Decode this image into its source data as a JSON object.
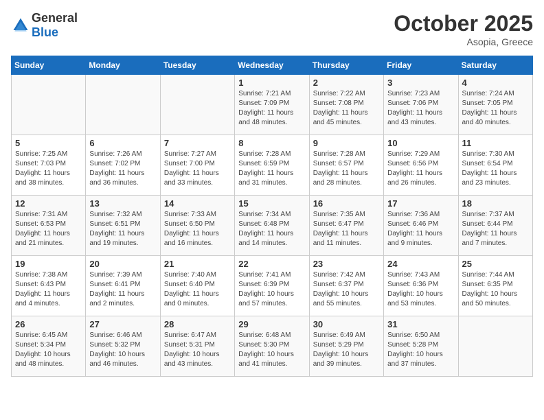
{
  "logo": {
    "general": "General",
    "blue": "Blue"
  },
  "title": "October 2025",
  "location": "Asopia, Greece",
  "weekdays": [
    "Sunday",
    "Monday",
    "Tuesday",
    "Wednesday",
    "Thursday",
    "Friday",
    "Saturday"
  ],
  "weeks": [
    [
      {
        "day": "",
        "info": ""
      },
      {
        "day": "",
        "info": ""
      },
      {
        "day": "",
        "info": ""
      },
      {
        "day": "1",
        "info": "Sunrise: 7:21 AM\nSunset: 7:09 PM\nDaylight: 11 hours\nand 48 minutes."
      },
      {
        "day": "2",
        "info": "Sunrise: 7:22 AM\nSunset: 7:08 PM\nDaylight: 11 hours\nand 45 minutes."
      },
      {
        "day": "3",
        "info": "Sunrise: 7:23 AM\nSunset: 7:06 PM\nDaylight: 11 hours\nand 43 minutes."
      },
      {
        "day": "4",
        "info": "Sunrise: 7:24 AM\nSunset: 7:05 PM\nDaylight: 11 hours\nand 40 minutes."
      }
    ],
    [
      {
        "day": "5",
        "info": "Sunrise: 7:25 AM\nSunset: 7:03 PM\nDaylight: 11 hours\nand 38 minutes."
      },
      {
        "day": "6",
        "info": "Sunrise: 7:26 AM\nSunset: 7:02 PM\nDaylight: 11 hours\nand 36 minutes."
      },
      {
        "day": "7",
        "info": "Sunrise: 7:27 AM\nSunset: 7:00 PM\nDaylight: 11 hours\nand 33 minutes."
      },
      {
        "day": "8",
        "info": "Sunrise: 7:28 AM\nSunset: 6:59 PM\nDaylight: 11 hours\nand 31 minutes."
      },
      {
        "day": "9",
        "info": "Sunrise: 7:28 AM\nSunset: 6:57 PM\nDaylight: 11 hours\nand 28 minutes."
      },
      {
        "day": "10",
        "info": "Sunrise: 7:29 AM\nSunset: 6:56 PM\nDaylight: 11 hours\nand 26 minutes."
      },
      {
        "day": "11",
        "info": "Sunrise: 7:30 AM\nSunset: 6:54 PM\nDaylight: 11 hours\nand 23 minutes."
      }
    ],
    [
      {
        "day": "12",
        "info": "Sunrise: 7:31 AM\nSunset: 6:53 PM\nDaylight: 11 hours\nand 21 minutes."
      },
      {
        "day": "13",
        "info": "Sunrise: 7:32 AM\nSunset: 6:51 PM\nDaylight: 11 hours\nand 19 minutes."
      },
      {
        "day": "14",
        "info": "Sunrise: 7:33 AM\nSunset: 6:50 PM\nDaylight: 11 hours\nand 16 minutes."
      },
      {
        "day": "15",
        "info": "Sunrise: 7:34 AM\nSunset: 6:48 PM\nDaylight: 11 hours\nand 14 minutes."
      },
      {
        "day": "16",
        "info": "Sunrise: 7:35 AM\nSunset: 6:47 PM\nDaylight: 11 hours\nand 11 minutes."
      },
      {
        "day": "17",
        "info": "Sunrise: 7:36 AM\nSunset: 6:46 PM\nDaylight: 11 hours\nand 9 minutes."
      },
      {
        "day": "18",
        "info": "Sunrise: 7:37 AM\nSunset: 6:44 PM\nDaylight: 11 hours\nand 7 minutes."
      }
    ],
    [
      {
        "day": "19",
        "info": "Sunrise: 7:38 AM\nSunset: 6:43 PM\nDaylight: 11 hours\nand 4 minutes."
      },
      {
        "day": "20",
        "info": "Sunrise: 7:39 AM\nSunset: 6:41 PM\nDaylight: 11 hours\nand 2 minutes."
      },
      {
        "day": "21",
        "info": "Sunrise: 7:40 AM\nSunset: 6:40 PM\nDaylight: 11 hours\nand 0 minutes."
      },
      {
        "day": "22",
        "info": "Sunrise: 7:41 AM\nSunset: 6:39 PM\nDaylight: 10 hours\nand 57 minutes."
      },
      {
        "day": "23",
        "info": "Sunrise: 7:42 AM\nSunset: 6:37 PM\nDaylight: 10 hours\nand 55 minutes."
      },
      {
        "day": "24",
        "info": "Sunrise: 7:43 AM\nSunset: 6:36 PM\nDaylight: 10 hours\nand 53 minutes."
      },
      {
        "day": "25",
        "info": "Sunrise: 7:44 AM\nSunset: 6:35 PM\nDaylight: 10 hours\nand 50 minutes."
      }
    ],
    [
      {
        "day": "26",
        "info": "Sunrise: 6:45 AM\nSunset: 5:34 PM\nDaylight: 10 hours\nand 48 minutes."
      },
      {
        "day": "27",
        "info": "Sunrise: 6:46 AM\nSunset: 5:32 PM\nDaylight: 10 hours\nand 46 minutes."
      },
      {
        "day": "28",
        "info": "Sunrise: 6:47 AM\nSunset: 5:31 PM\nDaylight: 10 hours\nand 43 minutes."
      },
      {
        "day": "29",
        "info": "Sunrise: 6:48 AM\nSunset: 5:30 PM\nDaylight: 10 hours\nand 41 minutes."
      },
      {
        "day": "30",
        "info": "Sunrise: 6:49 AM\nSunset: 5:29 PM\nDaylight: 10 hours\nand 39 minutes."
      },
      {
        "day": "31",
        "info": "Sunrise: 6:50 AM\nSunset: 5:28 PM\nDaylight: 10 hours\nand 37 minutes."
      },
      {
        "day": "",
        "info": ""
      }
    ]
  ]
}
